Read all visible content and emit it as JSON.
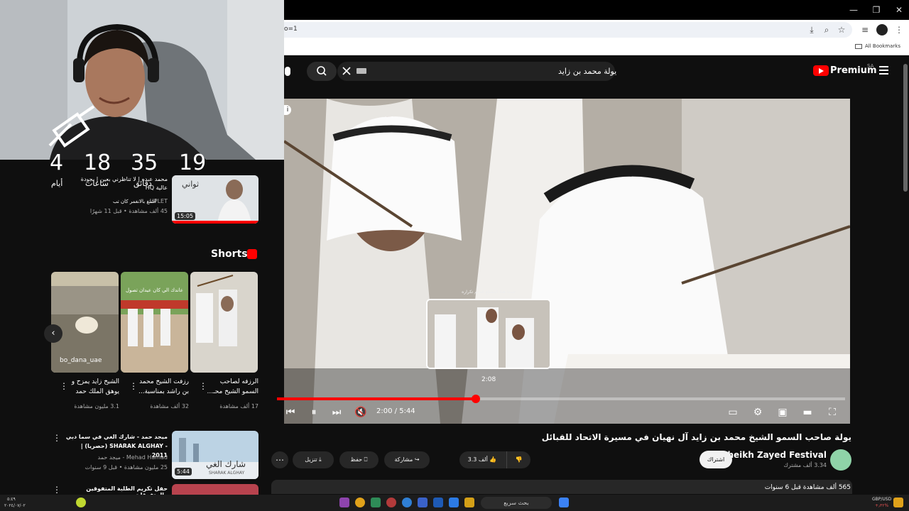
{
  "browser": {
    "url_fragment": "o=1",
    "bookmarks_label": "All Bookmarks"
  },
  "youtube": {
    "search_query": "يولة محمد بن زايد",
    "logo_text": "Premium",
    "region": "SA"
  },
  "sidebar": {
    "countdown": [
      {
        "num": "19",
        "label": "ثواني"
      },
      {
        "num": "35",
        "label": "دقائق"
      },
      {
        "num": "18",
        "label": "ساعات"
      },
      {
        "num": "4",
        "label": "أيام"
      }
    ],
    "top_item": {
      "title": "محمد عبده | لا تناظرني بعين | بجودة عالية HQ",
      "channel": "UPLET",
      "channel_note": "اشتغ بالانغمر كان تب",
      "meta": "45 ألف مشاهدة • قبل 11 شهرًا",
      "thumb_caption": "ثواني",
      "duration": "15:05"
    },
    "shorts_label": "Shorts",
    "shorts": [
      {
        "title": "الرزفه لصاحب السمو الشيخ محـ...",
        "views": "17 ألف مشاهدة"
      },
      {
        "title": "رزفت الشيخ محمد بن راشد بمناسبة...",
        "views": "32 ألف مشاهدة"
      },
      {
        "title": "الشيخ زايد يمزح و يوهق الملك حمد",
        "views": "3.1 مليون مشاهدة",
        "overlay": "bo_dana_uae"
      }
    ],
    "short_middle_caption": "عاندك الي كان عيدان تصول",
    "list_items": [
      {
        "title": "ميجد حمد - شارك الغي في سما دبي - SHARAK ALGHAY (حصريا) | 2011",
        "channel": "Mehad Hamad - ميجد حمد",
        "meta": "25 مليون مشاهدة • قبل 9 سنوات",
        "duration": "5:44",
        "thumb_caption": "شارك الغي",
        "thumb_caption_en": "SHARAK ALGHAY"
      },
      {
        "title": "حفل تكريم الطلبة المتفوقين والمتفوقات"
      }
    ]
  },
  "player": {
    "current_time": "2:00",
    "duration": "5:44",
    "progress": 0.35,
    "hover_time": "2:08",
    "preview_caption": "تنبيه: هذا المقطع قد تم تكراره"
  },
  "video": {
    "title": "يولة صاحب السمو الشيخ محمد بن زايد آل نهيان في مسيرة الاتحاد للقبائل",
    "channel": "Sheikh Zayed Festival",
    "subscribers": "3.34 ألف مشترك",
    "subscribe_label": "اشتراك",
    "likes": "3.3 ألف",
    "share_label": "مشاركة",
    "save_label": "حفظ",
    "download_label": "تنزيل",
    "views_line": "565 ألف مشاهدة  قبل 6 سنوات"
  },
  "taskbar": {
    "search_placeholder": "بحث سريع",
    "currency": "GBP/USD",
    "currency_change": "+٫٣٢%",
    "time": "٥:٤٩",
    "date": "٢٠٢٤/٠٧/٠٢"
  }
}
